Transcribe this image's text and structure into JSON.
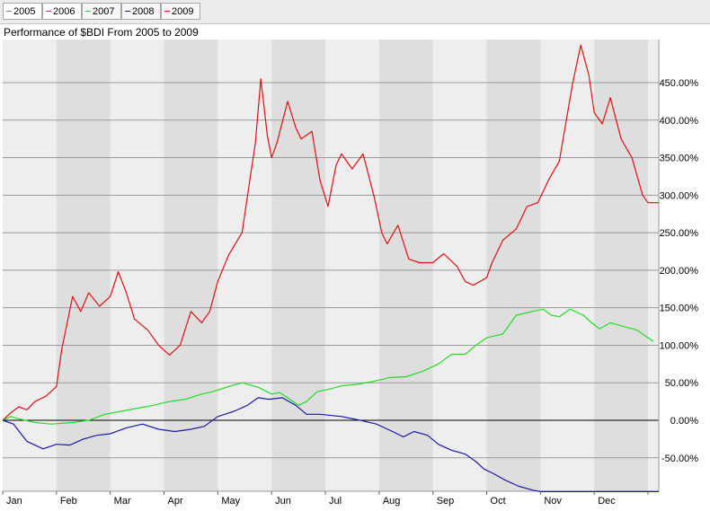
{
  "legend": {
    "items": [
      {
        "label": "2005",
        "color": "#888888"
      },
      {
        "label": "2006",
        "color": "#e020e0"
      },
      {
        "label": "2007",
        "color": "#22dd22"
      },
      {
        "label": "2008",
        "color": "#1a1aa8"
      },
      {
        "label": "2009",
        "color": "#e01010"
      }
    ]
  },
  "chart_data": {
    "type": "line",
    "title": "Performance of $BDI From 2005 to 2009",
    "xlabel": "",
    "ylabel": "",
    "x_axis": {
      "labels": [
        "Jan",
        "Feb",
        "Mar",
        "Apr",
        "May",
        "Jun",
        "Jul",
        "Aug",
        "Sep",
        "Oct",
        "Nov",
        "Dec"
      ],
      "range_months": [
        0,
        12
      ]
    },
    "y_axis": {
      "ticks": [
        450,
        400,
        350,
        300,
        250,
        200,
        150,
        100,
        50,
        0,
        -50
      ],
      "tick_labels": [
        "450.00%",
        "400.00%",
        "350.00%",
        "300.00%",
        "250.00%",
        "200.00%",
        "150.00%",
        "100.00%",
        "50.00%",
        "0.00%",
        "-50.00%"
      ],
      "range": [
        -95,
        500
      ],
      "position": "right"
    },
    "grid": true,
    "series": [
      {
        "name": "2009",
        "color": "#e01010",
        "points": [
          [
            0,
            0
          ],
          [
            0.15,
            10
          ],
          [
            0.3,
            18
          ],
          [
            0.45,
            14
          ],
          [
            0.6,
            25
          ],
          [
            0.8,
            32
          ],
          [
            1.0,
            45
          ],
          [
            1.1,
            95
          ],
          [
            1.3,
            165
          ],
          [
            1.45,
            145
          ],
          [
            1.6,
            170
          ],
          [
            1.8,
            152
          ],
          [
            2.0,
            165
          ],
          [
            2.15,
            198
          ],
          [
            2.3,
            170
          ],
          [
            2.45,
            135
          ],
          [
            2.7,
            120
          ],
          [
            2.9,
            100
          ],
          [
            3.1,
            87
          ],
          [
            3.3,
            100
          ],
          [
            3.5,
            145
          ],
          [
            3.7,
            130
          ],
          [
            3.85,
            145
          ],
          [
            4.0,
            185
          ],
          [
            4.2,
            220
          ],
          [
            4.45,
            250
          ],
          [
            4.7,
            370
          ],
          [
            4.8,
            455
          ],
          [
            4.92,
            380
          ],
          [
            5.0,
            350
          ],
          [
            5.1,
            370
          ],
          [
            5.3,
            425
          ],
          [
            5.45,
            390
          ],
          [
            5.55,
            375
          ],
          [
            5.75,
            385
          ],
          [
            5.9,
            320
          ],
          [
            6.05,
            285
          ],
          [
            6.2,
            340
          ],
          [
            6.3,
            355
          ],
          [
            6.5,
            335
          ],
          [
            6.7,
            355
          ],
          [
            6.9,
            300
          ],
          [
            7.05,
            250
          ],
          [
            7.15,
            235
          ],
          [
            7.35,
            260
          ],
          [
            7.55,
            215
          ],
          [
            7.75,
            210
          ],
          [
            8.0,
            210
          ],
          [
            8.2,
            222
          ],
          [
            8.45,
            205
          ],
          [
            8.6,
            185
          ],
          [
            8.75,
            180
          ],
          [
            9.0,
            190
          ],
          [
            9.1,
            210
          ],
          [
            9.3,
            240
          ],
          [
            9.55,
            255
          ],
          [
            9.75,
            285
          ],
          [
            9.95,
            290
          ],
          [
            10.15,
            320
          ],
          [
            10.35,
            345
          ],
          [
            10.6,
            450
          ],
          [
            10.75,
            500
          ],
          [
            10.9,
            460
          ],
          [
            11.0,
            410
          ],
          [
            11.15,
            395
          ],
          [
            11.3,
            430
          ],
          [
            11.5,
            375
          ],
          [
            11.7,
            350
          ],
          [
            11.9,
            300
          ],
          [
            12.0,
            290
          ],
          [
            12.2,
            290
          ]
        ]
      },
      {
        "name": "2007",
        "color": "#22dd22",
        "points": [
          [
            0,
            0
          ],
          [
            0.15,
            5
          ],
          [
            0.3,
            2
          ],
          [
            0.6,
            -3
          ],
          [
            0.9,
            -5
          ],
          [
            1.3,
            -3
          ],
          [
            1.6,
            0
          ],
          [
            1.9,
            8
          ],
          [
            2.2,
            12
          ],
          [
            2.5,
            16
          ],
          [
            2.8,
            20
          ],
          [
            3.1,
            25
          ],
          [
            3.4,
            28
          ],
          [
            3.7,
            35
          ],
          [
            3.9,
            38
          ],
          [
            4.2,
            45
          ],
          [
            4.45,
            50
          ],
          [
            4.75,
            44
          ],
          [
            5.0,
            35
          ],
          [
            5.15,
            37
          ],
          [
            5.3,
            30
          ],
          [
            5.5,
            20
          ],
          [
            5.65,
            25
          ],
          [
            5.85,
            38
          ],
          [
            6.1,
            42
          ],
          [
            6.3,
            46
          ],
          [
            6.6,
            48
          ],
          [
            6.9,
            52
          ],
          [
            7.2,
            57
          ],
          [
            7.5,
            58
          ],
          [
            7.8,
            65
          ],
          [
            8.1,
            75
          ],
          [
            8.35,
            88
          ],
          [
            8.6,
            88
          ],
          [
            8.8,
            100
          ],
          [
            9.0,
            110
          ],
          [
            9.3,
            115
          ],
          [
            9.55,
            140
          ],
          [
            9.85,
            145
          ],
          [
            10.05,
            148
          ],
          [
            10.2,
            140
          ],
          [
            10.35,
            138
          ],
          [
            10.55,
            148
          ],
          [
            10.8,
            140
          ],
          [
            10.95,
            130
          ],
          [
            11.1,
            122
          ],
          [
            11.3,
            130
          ],
          [
            11.55,
            125
          ],
          [
            11.8,
            120
          ],
          [
            12.0,
            110
          ],
          [
            12.1,
            105
          ]
        ]
      },
      {
        "name": "2008",
        "color": "#1a1aa8",
        "points": [
          [
            0,
            0
          ],
          [
            0.2,
            -5
          ],
          [
            0.45,
            -28
          ],
          [
            0.75,
            -38
          ],
          [
            1.0,
            -32
          ],
          [
            1.25,
            -33
          ],
          [
            1.5,
            -25
          ],
          [
            1.75,
            -20
          ],
          [
            2.0,
            -18
          ],
          [
            2.3,
            -10
          ],
          [
            2.6,
            -5
          ],
          [
            2.9,
            -12
          ],
          [
            3.2,
            -15
          ],
          [
            3.5,
            -12
          ],
          [
            3.75,
            -8
          ],
          [
            4.0,
            5
          ],
          [
            4.3,
            12
          ],
          [
            4.55,
            20
          ],
          [
            4.75,
            30
          ],
          [
            4.95,
            28
          ],
          [
            5.2,
            30
          ],
          [
            5.45,
            20
          ],
          [
            5.65,
            8
          ],
          [
            5.9,
            8
          ],
          [
            6.3,
            5
          ],
          [
            6.65,
            0
          ],
          [
            6.95,
            -5
          ],
          [
            7.25,
            -15
          ],
          [
            7.45,
            -22
          ],
          [
            7.65,
            -15
          ],
          [
            7.9,
            -20
          ],
          [
            8.1,
            -32
          ],
          [
            8.35,
            -40
          ],
          [
            8.6,
            -45
          ],
          [
            8.8,
            -55
          ],
          [
            8.95,
            -65
          ],
          [
            9.1,
            -70
          ],
          [
            9.35,
            -80
          ],
          [
            9.6,
            -88
          ],
          [
            9.85,
            -93
          ],
          [
            10.0,
            -95
          ],
          [
            10.4,
            -95
          ],
          [
            10.8,
            -95
          ],
          [
            11.2,
            -95
          ],
          [
            11.6,
            -95
          ],
          [
            12.0,
            -95
          ],
          [
            12.2,
            -95
          ]
        ]
      }
    ]
  }
}
